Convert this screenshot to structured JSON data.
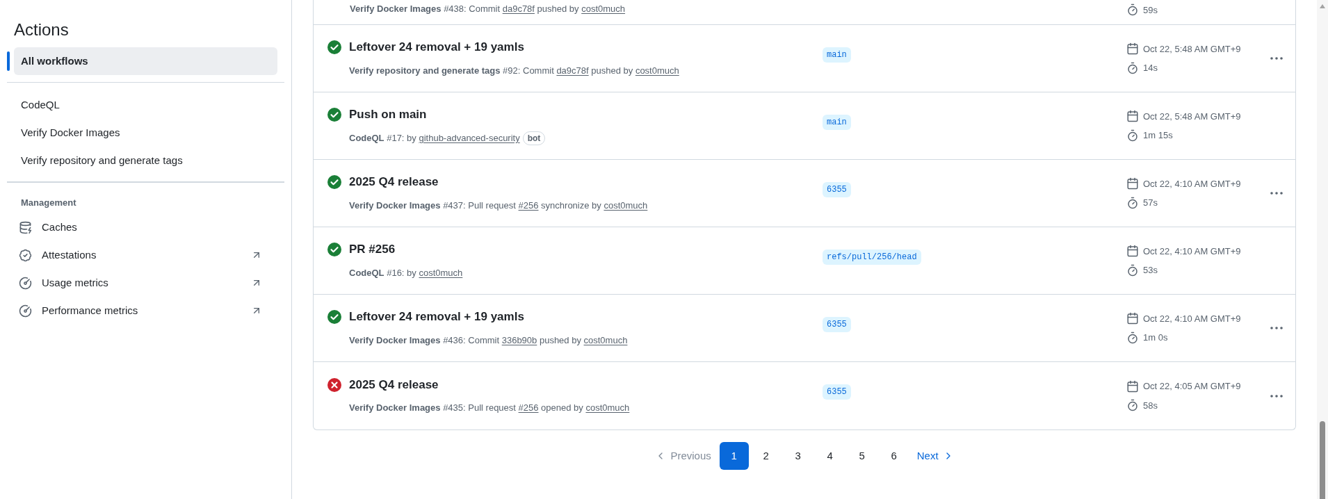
{
  "sidebar": {
    "title": "Actions",
    "items": [
      {
        "label": "All workflows",
        "selected": true
      }
    ],
    "workflows": [
      {
        "label": "CodeQL",
        "selected": false
      },
      {
        "label": "Verify Docker Images",
        "selected": false
      },
      {
        "label": "Verify repository and generate tags",
        "selected": false
      }
    ],
    "section_title": "Management",
    "management_items": [
      {
        "label": "Caches",
        "external": false
      },
      {
        "label": "Attestations",
        "external": true
      },
      {
        "label": "Usage metrics",
        "external": true
      },
      {
        "label": "Performance metrics",
        "external": true
      }
    ]
  },
  "clipped_run": {
    "subtitle": [
      {
        "kind": "bold",
        "text": "Verify Docker Images"
      },
      {
        "kind": "text",
        "text": " #438: Commit "
      },
      {
        "kind": "link",
        "text": "da9c78f"
      },
      {
        "kind": "text",
        "text": " pushed by "
      },
      {
        "kind": "link",
        "text": "cost0much"
      }
    ],
    "duration": "59s"
  },
  "runs": [
    {
      "title": "Leftover 24 removal + 19 yamls",
      "success": true,
      "subtitle": [
        {
          "kind": "bold",
          "text": "Verify repository and generate tags"
        },
        {
          "kind": "text",
          "text": " #92: Commit "
        },
        {
          "kind": "link",
          "text": "da9c78f"
        },
        {
          "kind": "text",
          "text": " pushed by "
        },
        {
          "kind": "link",
          "text": "cost0much"
        }
      ],
      "branch": "main",
      "date": "Oct 22, 5:48 AM GMT+9",
      "duration": "14s",
      "menu": true
    },
    {
      "title": "Push on main",
      "success": true,
      "subtitle": [
        {
          "kind": "bold",
          "text": "CodeQL"
        },
        {
          "kind": "text",
          "text": " #17: by "
        },
        {
          "kind": "link",
          "text": "github-advanced-security"
        },
        {
          "kind": "badge",
          "text": "bot"
        }
      ],
      "branch": "main",
      "date": "Oct 22, 5:48 AM GMT+9",
      "duration": "1m 15s",
      "menu": false
    },
    {
      "title": "2025 Q4 release",
      "success": true,
      "subtitle": [
        {
          "kind": "bold",
          "text": "Verify Docker Images"
        },
        {
          "kind": "text",
          "text": " #437: Pull request "
        },
        {
          "kind": "link",
          "text": "#256"
        },
        {
          "kind": "text",
          "text": " synchronize by "
        },
        {
          "kind": "link",
          "text": "cost0much"
        }
      ],
      "branch": "6355",
      "date": "Oct 22, 4:10 AM GMT+9",
      "duration": "57s",
      "menu": true
    },
    {
      "title": "PR #256",
      "success": true,
      "subtitle": [
        {
          "kind": "bold",
          "text": "CodeQL"
        },
        {
          "kind": "text",
          "text": " #16: by "
        },
        {
          "kind": "link",
          "text": "cost0much"
        }
      ],
      "branch": "refs/pull/256/head",
      "date": "Oct 22, 4:10 AM GMT+9",
      "duration": "53s",
      "menu": false
    },
    {
      "title": "Leftover 24 removal + 19 yamls",
      "success": true,
      "subtitle": [
        {
          "kind": "bold",
          "text": "Verify Docker Images"
        },
        {
          "kind": "text",
          "text": " #436: Commit "
        },
        {
          "kind": "link",
          "text": "336b90b"
        },
        {
          "kind": "text",
          "text": " pushed by "
        },
        {
          "kind": "link",
          "text": "cost0much"
        }
      ],
      "branch": "6355",
      "date": "Oct 22, 4:10 AM GMT+9",
      "duration": "1m 0s",
      "menu": true
    },
    {
      "title": "2025 Q4 release",
      "success": false,
      "subtitle": [
        {
          "kind": "bold",
          "text": "Verify Docker Images"
        },
        {
          "kind": "text",
          "text": " #435: Pull request "
        },
        {
          "kind": "link",
          "text": "#256"
        },
        {
          "kind": "text",
          "text": " opened by "
        },
        {
          "kind": "link",
          "text": "cost0much"
        }
      ],
      "branch": "6355",
      "date": "Oct 22, 4:05 AM GMT+9",
      "duration": "58s",
      "menu": true
    }
  ],
  "pagination": {
    "previous": "Previous",
    "previous_disabled": true,
    "pages": [
      {
        "label": "1",
        "selected": true
      },
      {
        "label": "2",
        "selected": false
      },
      {
        "label": "3",
        "selected": false
      },
      {
        "label": "4",
        "selected": false
      },
      {
        "label": "5",
        "selected": false
      },
      {
        "label": "6",
        "selected": false
      }
    ],
    "next": "Next"
  }
}
